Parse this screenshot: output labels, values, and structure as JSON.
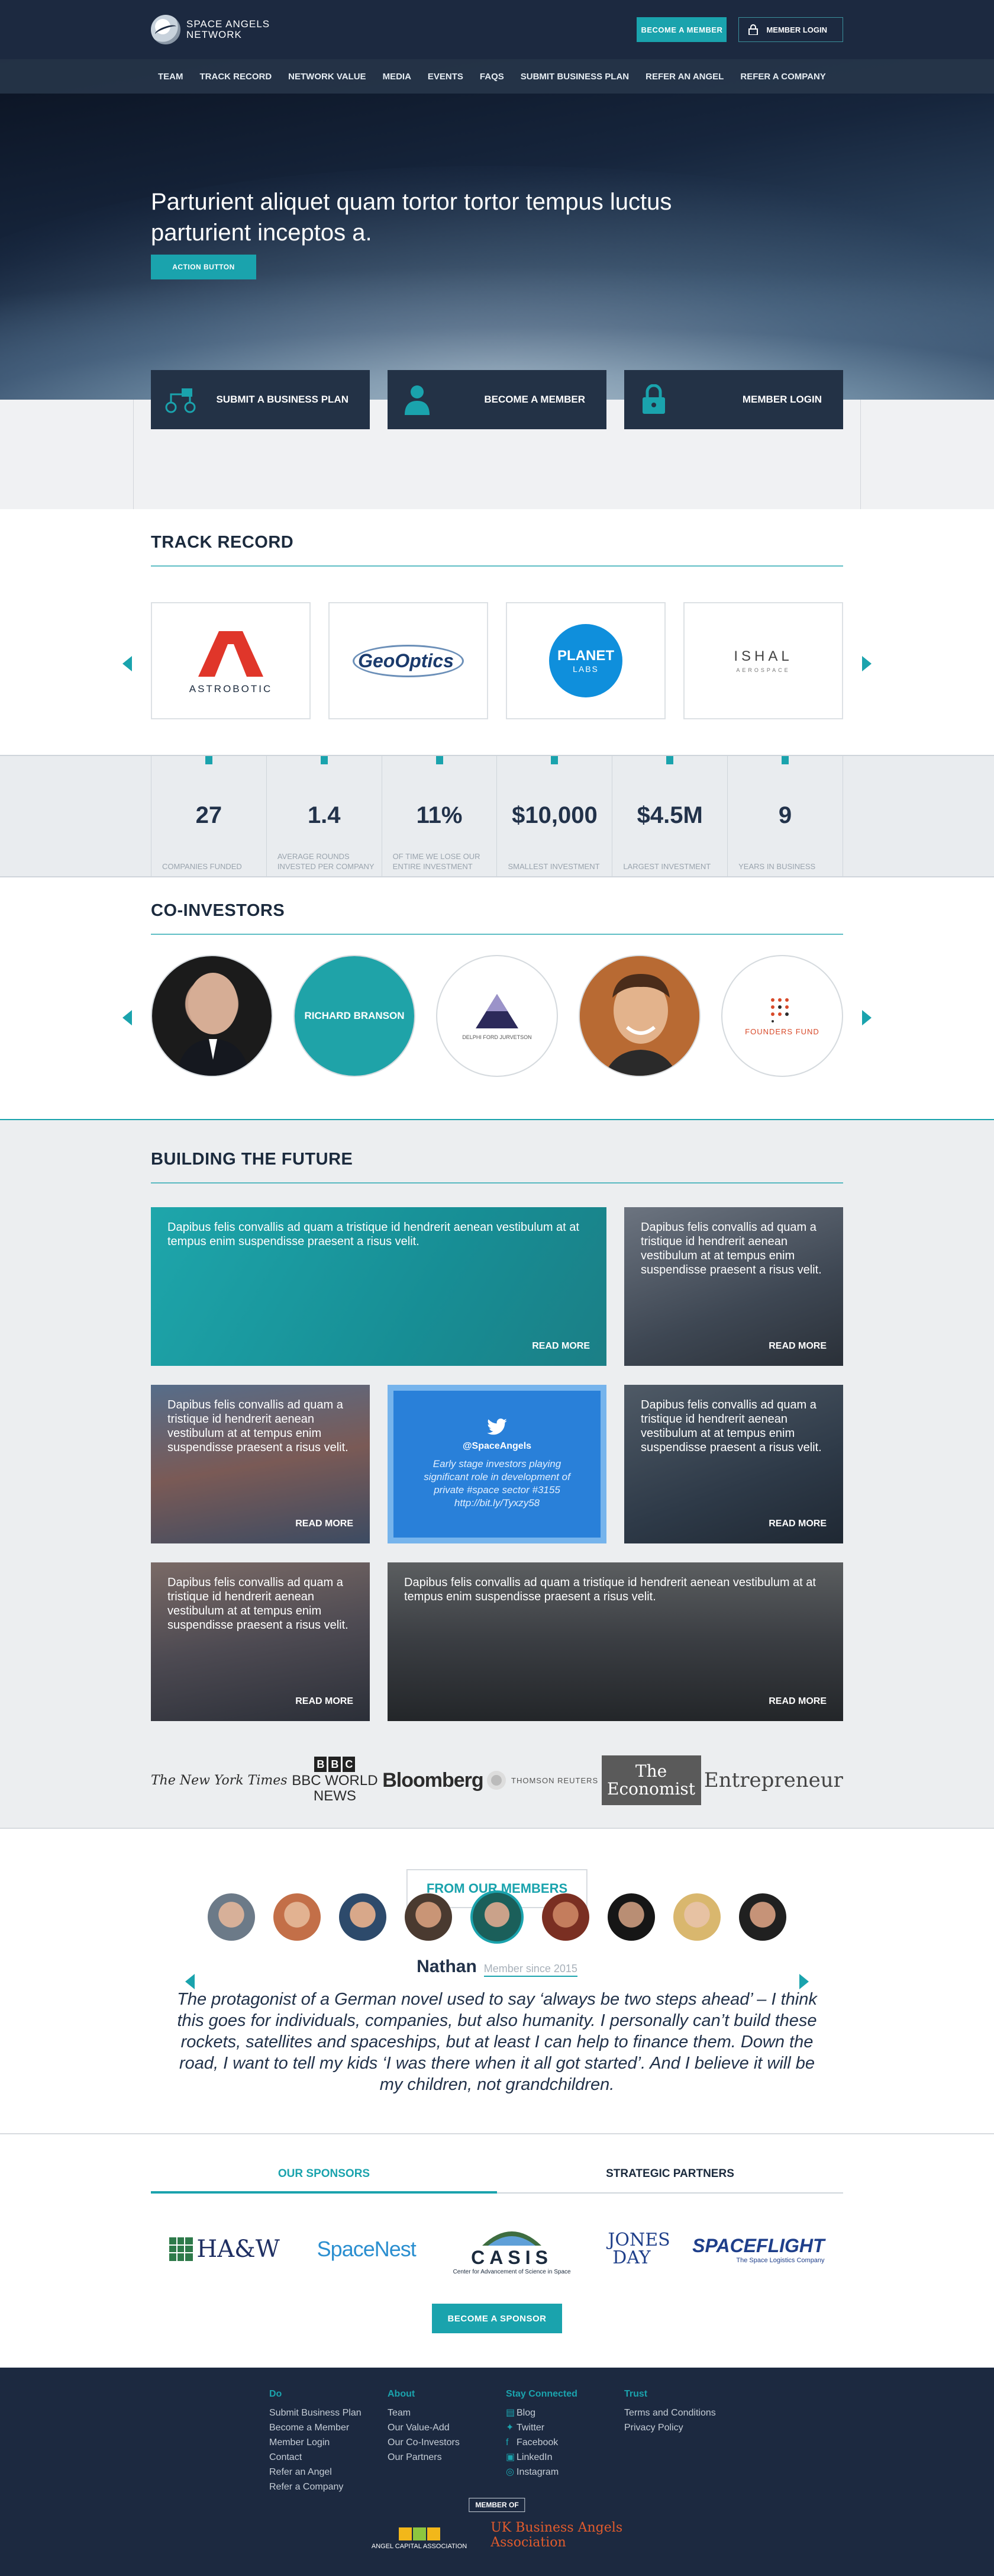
{
  "header": {
    "logo_line1": "SPACE ANGELS",
    "logo_line2": "NETWORK",
    "become_member": "BECOME A MEMBER",
    "member_login": "MEMBER LOGIN"
  },
  "nav": [
    "TEAM",
    "TRACK RECORD",
    "NETWORK VALUE",
    "MEDIA",
    "EVENTS",
    "FAQS",
    "SUBMIT BUSINESS PLAN",
    "REFER AN ANGEL",
    "REFER A COMPANY"
  ],
  "hero": {
    "title": "Parturient aliquet quam tortor tortor tempus luctus parturient inceptos a.",
    "button": "ACTION BUTTON"
  },
  "actions": [
    {
      "label": "SUBMIT A BUSINESS PLAN",
      "icon": "business-plan-icon"
    },
    {
      "label": "BECOME A MEMBER",
      "icon": "person-icon"
    },
    {
      "label": "MEMBER LOGIN",
      "icon": "lock-icon"
    }
  ],
  "track_record": {
    "title": "TRACK RECORD",
    "logos": [
      {
        "name": "ASTROBOTIC"
      },
      {
        "name": "GeoOptics"
      },
      {
        "name": "PLANET",
        "sub": "LABS"
      },
      {
        "name": "ISHAL",
        "sub": "AEROSPACE"
      }
    ]
  },
  "stats": [
    {
      "value": "27",
      "label": "COMPANIES FUNDED"
    },
    {
      "value": "1.4",
      "label": "AVERAGE ROUNDS INVESTED PER COMPANY"
    },
    {
      "value": "11%",
      "label": "OF TIME WE LOSE OUR ENTIRE INVESTMENT"
    },
    {
      "value": "$10,000",
      "label": "SMALLEST INVESTMENT"
    },
    {
      "value": "$4.5M",
      "label": "LARGEST INVESTMENT"
    },
    {
      "value": "9",
      "label": "YEARS IN BUSINESS"
    }
  ],
  "coinvestors": {
    "title": "CO-INVESTORS",
    "items": [
      {
        "name": ""
      },
      {
        "name": "RICHARD BRANSON"
      },
      {
        "name": "DELPHI FORD JURVETSON"
      },
      {
        "name": ""
      },
      {
        "name": "FOUNDERS FUND"
      }
    ]
  },
  "future": {
    "title": "BUILDING THE FUTURE",
    "tile_text": "Dapibus felis convallis ad quam a tristique id hendrerit aenean vestibulum at at tempus enim suspendisse praesent a risus velit.",
    "read_more": "READ MORE",
    "tweet": {
      "handle": "@SpaceAngels",
      "text": "Early stage investors playing significant role in development of private #space sector #3155 http://bit.ly/Tyxzy58"
    }
  },
  "press": [
    "The New York Times",
    "BBC WORLD NEWS",
    "Bloomberg",
    "THOMSON REUTERS",
    "The Economist",
    "Entrepreneur"
  ],
  "members": {
    "tag": "FROM OUR MEMBERS",
    "name": "Nathan",
    "since": "Member since 2015",
    "quote": "The protagonist of a German novel used to say ‘always be two steps ahead’ – I think this goes for individuals, companies, but also humanity. I personally can’t build these rockets, satellites and spaceships, but at least I can help to finance them. Down the road, I want to tell my kids ‘I was there when it all got started’. And I believe it will be my children, not grandchildren."
  },
  "sponsors": {
    "tab_sponsors": "OUR SPONSORS",
    "tab_partners": "STRATEGIC PARTNERS",
    "logos": [
      "HA&W",
      "SpaceNest",
      "CASIS",
      "JONES DAY",
      "SPACEFLIGHT"
    ],
    "casis_sub": "Center for Advancement of Science in Space",
    "spaceflight_sub": "The Space Logistics Company",
    "button": "BECOME A  SPONSOR"
  },
  "footer": {
    "cols": [
      {
        "title": "Do",
        "items": [
          "Submit Business Plan",
          "Become a Member",
          "Member Login",
          "Contact",
          "Refer an Angel",
          "Refer a Company"
        ]
      },
      {
        "title": "About",
        "items": [
          "Team",
          "Our Value-Add",
          "Our Co-Investors",
          "Our Partners"
        ]
      },
      {
        "title": "Stay Connected",
        "items": [
          "Blog",
          "Twitter",
          "Facebook",
          "LinkedIn",
          "Instagram"
        ]
      },
      {
        "title": "Trust",
        "items": [
          "Terms and Conditions",
          "Privacy Policy"
        ]
      }
    ],
    "member_of": "MEMBER OF",
    "aca": "ANGEL CAPITAL ASSOCIATION",
    "ukba_line1": "UK Business Angels",
    "ukba_line2": "Association"
  },
  "colors": {
    "accent": "#1aa3ad",
    "navy": "#1c2940",
    "tile_teal": "#1fa3a8"
  }
}
